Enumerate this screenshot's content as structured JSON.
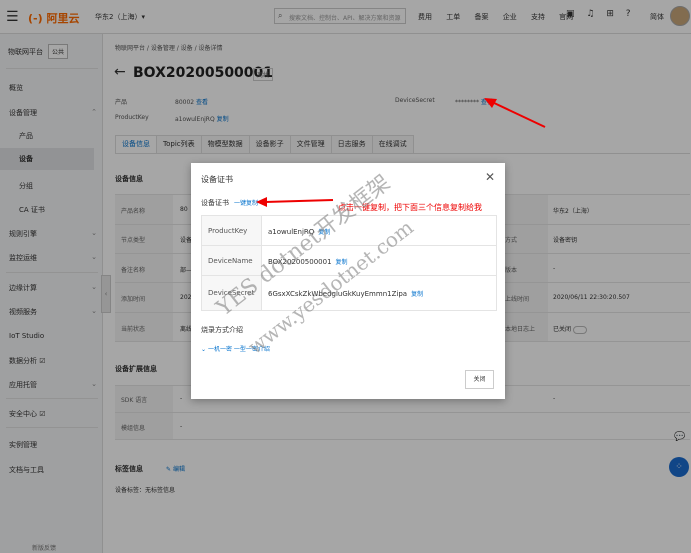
{
  "topbar": {
    "menu_icon": "hamburger-icon",
    "logo": "(-) 阿里云",
    "region": "华东2（上海）▾",
    "search_placeholder": "搜索文档、控制台、API、解决方案和资源",
    "links": [
      "费用",
      "工单",
      "备案",
      "企业",
      "支持",
      "官网"
    ],
    "user": "简体"
  },
  "sidebar": {
    "title": "物联网平台",
    "badge": "公共",
    "items": [
      {
        "label": "概览"
      },
      {
        "label": "设备管理"
      },
      {
        "label": "产品"
      },
      {
        "label": "设备"
      },
      {
        "label": "分组"
      },
      {
        "label": "CA 证书"
      },
      {
        "label": "规则引擎"
      },
      {
        "label": "监控运维"
      },
      {
        "label": "边缘计算"
      },
      {
        "label": "视频服务"
      },
      {
        "label": "IoT Studio"
      },
      {
        "label": "数据分析 ☑"
      },
      {
        "label": "应用托管"
      },
      {
        "label": "安全中心 ☑"
      },
      {
        "label": "实例管理"
      },
      {
        "label": "文档与工具"
      }
    ],
    "feedback": "新版反馈"
  },
  "breadcrumb": "物联网平台 / 设备管理 / 设备 / 设备详情",
  "device": {
    "name": "BOX20200500001",
    "status": "离线",
    "product_label": "产品",
    "product_value": "80002",
    "view": "查看",
    "productkey_label": "ProductKey",
    "productkey_value": "a1owulEnjRQ",
    "copy": "复制",
    "secret_label": "DeviceSecret",
    "secret_value": "********"
  },
  "tabs": [
    "设备信息",
    "Topic列表",
    "物模型数据",
    "设备影子",
    "文件管理",
    "日志服务",
    "在线调试"
  ],
  "info_section": {
    "title": "设备信息",
    "labels": [
      "产品名称",
      "节点类型",
      "备注名称",
      "添加时间",
      "当前状态"
    ],
    "values": [
      "80",
      "设备",
      "部—",
      "2020",
      "离线"
    ],
    "right_labels": [
      "",
      "方式",
      "版本",
      "上线时间",
      "本地日志上"
    ],
    "right_values": [
      "华东2（上海）",
      "设备密钥",
      "-",
      "2020/06/11 22:30:20.507",
      "已关闭"
    ]
  },
  "extend_section": {
    "title": "设备扩展信息",
    "labels": [
      "SDK 语言",
      "模组信息"
    ],
    "values": [
      "-",
      "-"
    ],
    "mid_values": [
      "-",
      "-"
    ],
    "right_values": [
      "-"
    ]
  },
  "tag_section": {
    "title": "标签信息",
    "edit": "编辑",
    "tags": "设备标签：无标签信息"
  },
  "modal": {
    "title": "设备证书",
    "cert_label": "设备证书",
    "one_copy": "一键复制",
    "rows": [
      {
        "key": "ProductKey",
        "value": "a1owulEnjRQ",
        "copy": "复制"
      },
      {
        "key": "DeviceName",
        "value": "BOX20200500001",
        "copy": "复制"
      },
      {
        "key": "DeviceSecret",
        "value": "6GsxXCskZkWbedgluGkKuyEmmn1Zipa",
        "copy": "复制"
      }
    ],
    "burn_title": "烧录方式介绍",
    "burn_links": "一机一密  一型一密介绍",
    "close": "关闭"
  },
  "annotation": "点击一键复制，把下面三个信息复制给我",
  "watermarks": [
    "YES dotnet开发框架",
    "www.yesdotnet.com"
  ],
  "colors": {
    "accent": "#0070cc",
    "brand": "#ff6a00",
    "annotation": "#e00000"
  }
}
